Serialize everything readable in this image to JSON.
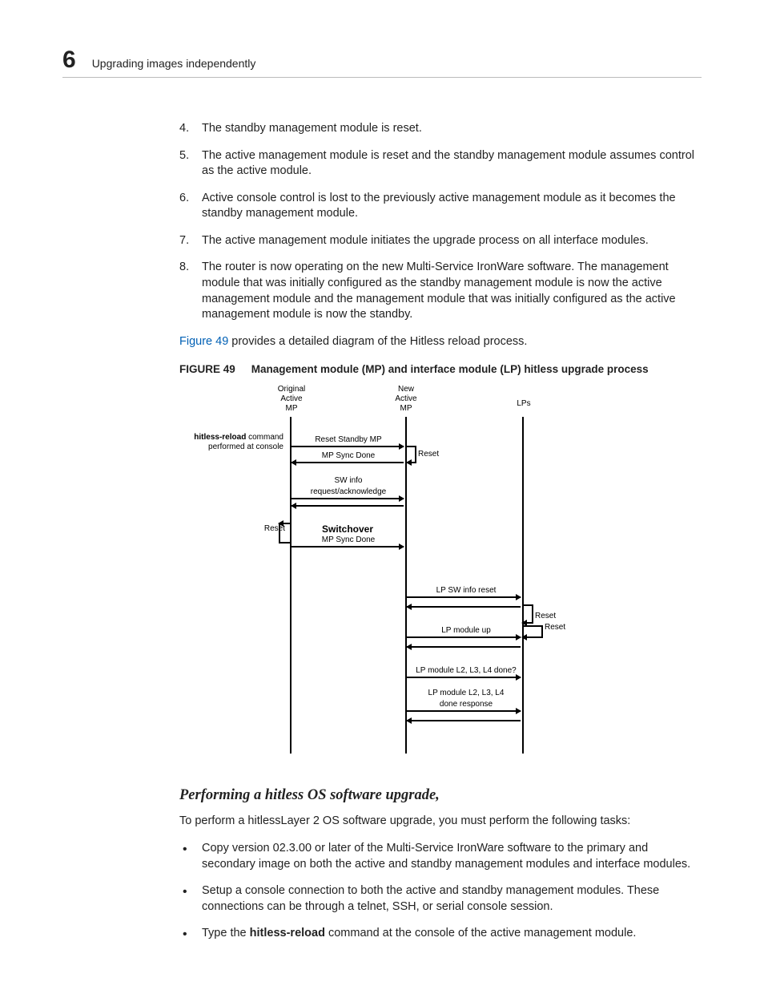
{
  "header": {
    "chapter_number": "6",
    "title": "Upgrading images independently"
  },
  "steps": [
    {
      "n": "4.",
      "text": "The standby management module is reset."
    },
    {
      "n": "5.",
      "text": "The active management module is reset and the standby management module assumes control as the active module."
    },
    {
      "n": "6.",
      "text": "Active console control is lost to the previously active management module as it becomes the standby management module."
    },
    {
      "n": "7.",
      "text": "The active management module initiates the upgrade process on all interface modules."
    },
    {
      "n": "8.",
      "text": "The router is now operating on the new Multi-Service IronWare software. The management module that was initially configured as the standby management module is now the active management module and the management module that was initially configured as the active management module is now the standby."
    }
  ],
  "fig_ref_link": "Figure 49",
  "fig_ref_rest": " provides a detailed diagram of the Hitless reload process.",
  "figure": {
    "label": "FIGURE 49",
    "title": "Management module (MP) and interface module (LP) hitless upgrade process",
    "lifelines": {
      "orig_mp": "Original\nActive\nMP",
      "new_mp": "New\nActive\nMP",
      "lps": "LPs"
    },
    "console_note_b": "hitless-reload",
    "console_note_r": " command performed at console",
    "messages": {
      "reset_standby_mp": "Reset Standby MP",
      "mp_sync_done_1": "MP Sync Done",
      "reset_1": "Reset",
      "sw_info": "SW info\nrequest/acknowledge",
      "reset_2": "Reset",
      "switchover": "Switchover",
      "mp_sync_done_2": "MP Sync Done",
      "lp_sw_info_reset": "LP SW info reset",
      "reset_3": "Reset",
      "reset_4": "Reset",
      "lp_module_up": "LP module up",
      "lp_done_q": "LP module L2, L3, L4 done?",
      "lp_done_r": "LP module L2, L3, L4\ndone response"
    }
  },
  "section": {
    "heading": "Performing a hitless OS software upgrade,",
    "intro": "To perform a hitlessLayer 2 OS software upgrade, you must perform the following tasks:",
    "bullets": [
      "Copy version 02.3.00 or later of the Multi-Service IronWare software to the primary and secondary image on both the active and standby management modules and interface modules.",
      "Setup a console connection to both the active and standby management modules. These connections can be through a telnet, SSH, or serial console session."
    ],
    "bullet3_pre": "Type the ",
    "bullet3_bold": "hitless-reload",
    "bullet3_post": " command at the console of the active management module."
  }
}
